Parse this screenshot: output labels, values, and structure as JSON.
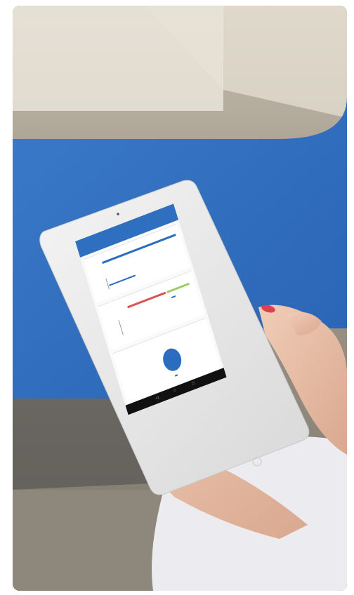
{
  "scene": {
    "description_tags": [
      "tablet",
      "hands",
      "blue-bench",
      "outdoor"
    ],
    "colors": {
      "bench_blue": "#2f6fc6",
      "app_bar": "#2f6fbf",
      "bar_blue": "#2a6cc0",
      "bar_red": "#d9534f",
      "bar_green": "#9ccc65",
      "pie_blue": "#2a6cc0"
    }
  },
  "tablet_app": {
    "title": "",
    "status": "",
    "cards": [
      {
        "title": ""
      },
      {
        "title": ""
      },
      {
        "title": ""
      }
    ],
    "nav_icons": [
      "back-icon",
      "home-icon",
      "recents-icon"
    ]
  }
}
